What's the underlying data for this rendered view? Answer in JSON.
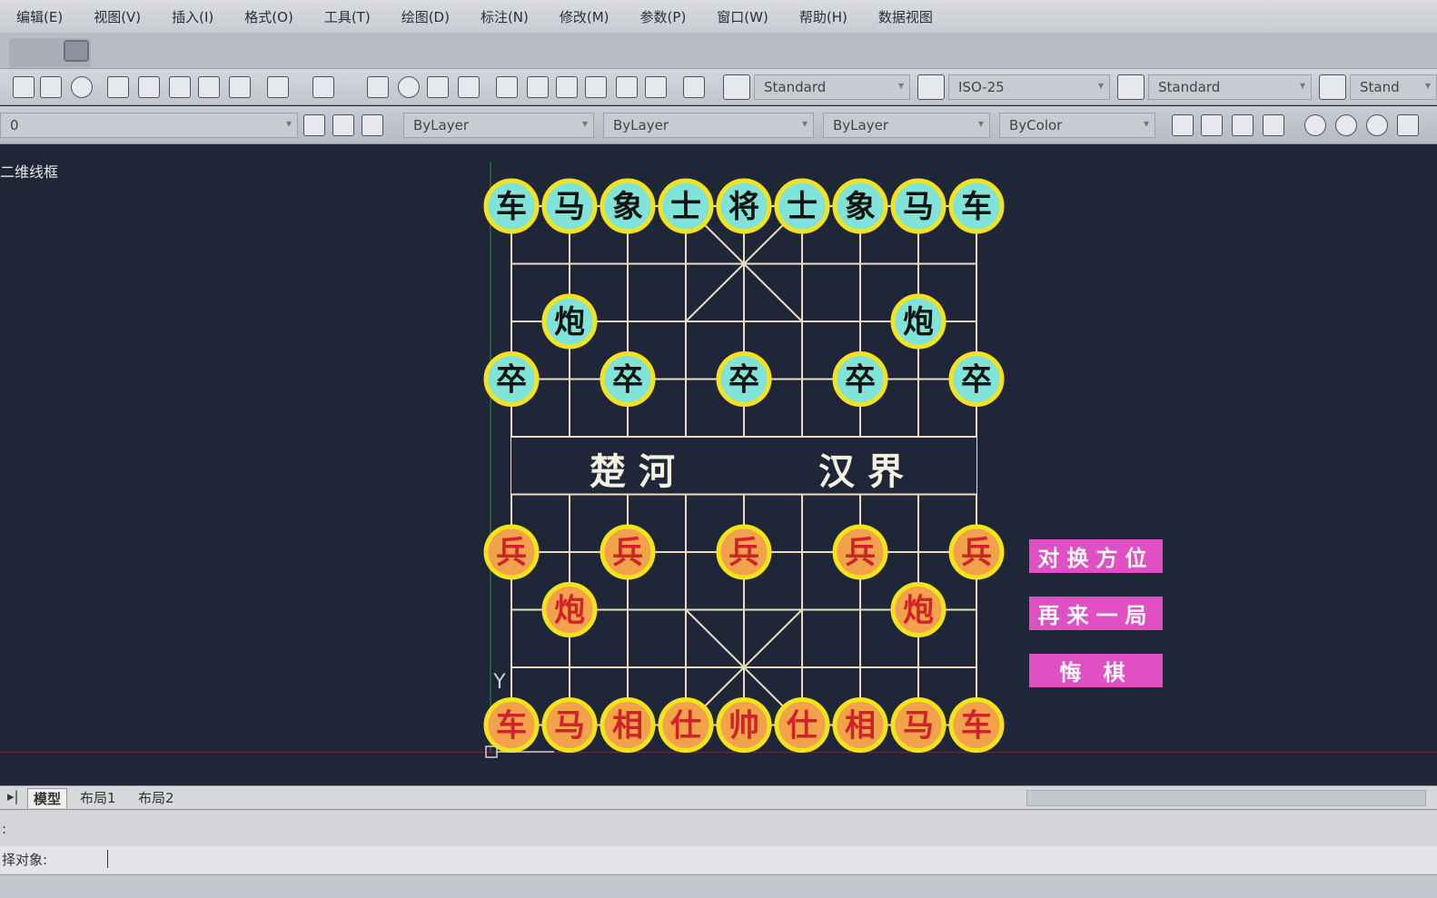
{
  "menu": [
    "编辑(E)",
    "视图(V)",
    "插入(I)",
    "格式(O)",
    "工具(T)",
    "绘图(D)",
    "标注(N)",
    "修改(M)",
    "参数(P)",
    "窗口(W)",
    "帮助(H)",
    "数据视图"
  ],
  "toolbar": {
    "text_style": "Standard",
    "dim_style": "ISO-25",
    "table_style": "Standard",
    "multileader_style": "Stand",
    "layer": "0",
    "color": "ByLayer",
    "linetype": "ByLayer",
    "lineweight": "ByLayer",
    "plotstyle": "ByColor"
  },
  "viewport_label": "二维线框",
  "ucs_label": "Y",
  "board": {
    "river_left": "楚 河",
    "river_right": "汉 界",
    "top_row": [
      "车",
      "马",
      "象",
      "士",
      "将",
      "士",
      "象",
      "马",
      "车"
    ],
    "top_cannons": [
      "炮",
      "炮"
    ],
    "top_soldiers": [
      "卒",
      "卒",
      "卒",
      "卒",
      "卒"
    ],
    "bottom_soldiers": [
      "兵",
      "兵",
      "兵",
      "兵",
      "兵"
    ],
    "bottom_cannons": [
      "炮",
      "炮"
    ],
    "bottom_row": [
      "车",
      "马",
      "相",
      "仕",
      "帅",
      "仕",
      "相",
      "马",
      "车"
    ]
  },
  "buttons": {
    "swap": "对换方位",
    "again": "再来一局",
    "undo": "悔 棋"
  },
  "layout_tabs": [
    "模型",
    "布局1",
    "布局2"
  ],
  "command": {
    "line1": ":",
    "prompt": "择对象:"
  },
  "colors": {
    "board_line": "#e9ddc2",
    "piece_top_fill": "#7fe3d9",
    "piece_bottom_fill": "#f2a24a",
    "piece_ring": "#f3e21c",
    "bottom_char": "#d0222a",
    "top_char": "#111111",
    "button_pink": "#e14fc4"
  }
}
